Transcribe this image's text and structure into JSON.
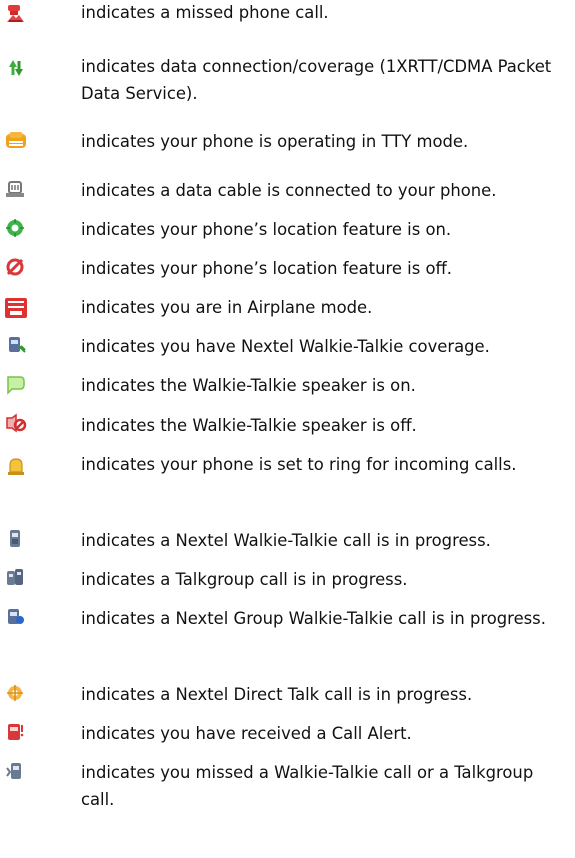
{
  "items": [
    {
      "icon": "missed-call-icon",
      "text": "indicates a missed phone call."
    },
    {
      "icon": "data-connection-icon",
      "text": "indicates data connection/coverage (1XRTT/CDMA Packet Data Service)."
    },
    {
      "icon": "tty-mode-icon",
      "text": "indicates your phone is operating in TTY mode."
    },
    {
      "icon": "data-cable-icon",
      "text": "indicates a data cable is connected to your phone."
    },
    {
      "icon": "location-on-icon",
      "text": "indicates your phone’s location feature is on."
    },
    {
      "icon": "location-off-icon",
      "text": "indicates your phone’s location feature is off."
    },
    {
      "icon": "phone-off-icon",
      "text": "indicates you are in Airplane mode."
    },
    {
      "icon": "walkie-talkie-coverage-icon",
      "text": "indicates you have Nextel Walkie-Talkie coverage."
    },
    {
      "icon": "speaker-on-icon",
      "text": "indicates the Walkie-Talkie speaker is on."
    },
    {
      "icon": "speaker-off-icon",
      "text": "indicates the Walkie-Talkie speaker is off."
    },
    {
      "icon": "ringer-bell-icon",
      "text": "indicates your phone is set to ring for incoming calls."
    },
    {
      "icon": "walkie-talkie-call-icon",
      "text": "indicates a Nextel Walkie-Talkie call is in progress."
    },
    {
      "icon": "talkgroup-call-icon",
      "text": "indicates a Talkgroup call is in progress."
    },
    {
      "icon": "group-call-icon",
      "text": "indicates a Nextel Group Walkie-Talkie call is in progress."
    },
    {
      "icon": "direct-talk-icon",
      "text": "indicates a Nextel Direct Talk call is in progress."
    },
    {
      "icon": "call-alert-icon",
      "text": "indicates you have received a Call Alert."
    },
    {
      "icon": "missed-walkie-talkie-icon",
      "text": "indicates you missed a Walkie-Talkie call or a Talkgroup call."
    }
  ]
}
